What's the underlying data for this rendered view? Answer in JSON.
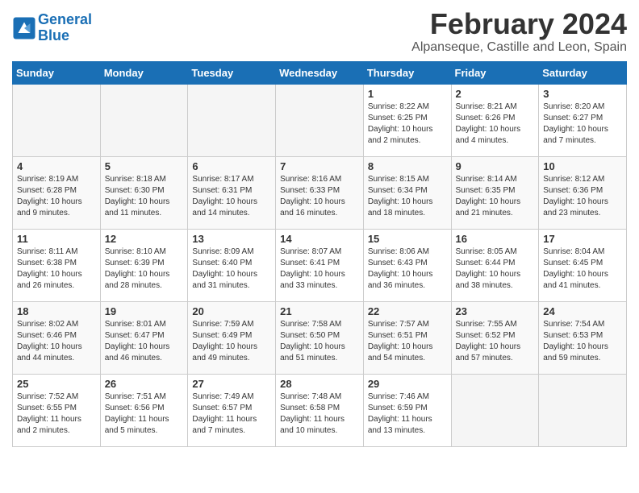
{
  "header": {
    "logo_line1": "General",
    "logo_line2": "Blue",
    "title": "February 2024",
    "subtitle": "Alpanseque, Castille and Leon, Spain"
  },
  "weekdays": [
    "Sunday",
    "Monday",
    "Tuesday",
    "Wednesday",
    "Thursday",
    "Friday",
    "Saturday"
  ],
  "weeks": [
    [
      {
        "day": "",
        "info": ""
      },
      {
        "day": "",
        "info": ""
      },
      {
        "day": "",
        "info": ""
      },
      {
        "day": "",
        "info": ""
      },
      {
        "day": "1",
        "info": "Sunrise: 8:22 AM\nSunset: 6:25 PM\nDaylight: 10 hours\nand 2 minutes."
      },
      {
        "day": "2",
        "info": "Sunrise: 8:21 AM\nSunset: 6:26 PM\nDaylight: 10 hours\nand 4 minutes."
      },
      {
        "day": "3",
        "info": "Sunrise: 8:20 AM\nSunset: 6:27 PM\nDaylight: 10 hours\nand 7 minutes."
      }
    ],
    [
      {
        "day": "4",
        "info": "Sunrise: 8:19 AM\nSunset: 6:28 PM\nDaylight: 10 hours\nand 9 minutes."
      },
      {
        "day": "5",
        "info": "Sunrise: 8:18 AM\nSunset: 6:30 PM\nDaylight: 10 hours\nand 11 minutes."
      },
      {
        "day": "6",
        "info": "Sunrise: 8:17 AM\nSunset: 6:31 PM\nDaylight: 10 hours\nand 14 minutes."
      },
      {
        "day": "7",
        "info": "Sunrise: 8:16 AM\nSunset: 6:33 PM\nDaylight: 10 hours\nand 16 minutes."
      },
      {
        "day": "8",
        "info": "Sunrise: 8:15 AM\nSunset: 6:34 PM\nDaylight: 10 hours\nand 18 minutes."
      },
      {
        "day": "9",
        "info": "Sunrise: 8:14 AM\nSunset: 6:35 PM\nDaylight: 10 hours\nand 21 minutes."
      },
      {
        "day": "10",
        "info": "Sunrise: 8:12 AM\nSunset: 6:36 PM\nDaylight: 10 hours\nand 23 minutes."
      }
    ],
    [
      {
        "day": "11",
        "info": "Sunrise: 8:11 AM\nSunset: 6:38 PM\nDaylight: 10 hours\nand 26 minutes."
      },
      {
        "day": "12",
        "info": "Sunrise: 8:10 AM\nSunset: 6:39 PM\nDaylight: 10 hours\nand 28 minutes."
      },
      {
        "day": "13",
        "info": "Sunrise: 8:09 AM\nSunset: 6:40 PM\nDaylight: 10 hours\nand 31 minutes."
      },
      {
        "day": "14",
        "info": "Sunrise: 8:07 AM\nSunset: 6:41 PM\nDaylight: 10 hours\nand 33 minutes."
      },
      {
        "day": "15",
        "info": "Sunrise: 8:06 AM\nSunset: 6:43 PM\nDaylight: 10 hours\nand 36 minutes."
      },
      {
        "day": "16",
        "info": "Sunrise: 8:05 AM\nSunset: 6:44 PM\nDaylight: 10 hours\nand 38 minutes."
      },
      {
        "day": "17",
        "info": "Sunrise: 8:04 AM\nSunset: 6:45 PM\nDaylight: 10 hours\nand 41 minutes."
      }
    ],
    [
      {
        "day": "18",
        "info": "Sunrise: 8:02 AM\nSunset: 6:46 PM\nDaylight: 10 hours\nand 44 minutes."
      },
      {
        "day": "19",
        "info": "Sunrise: 8:01 AM\nSunset: 6:47 PM\nDaylight: 10 hours\nand 46 minutes."
      },
      {
        "day": "20",
        "info": "Sunrise: 7:59 AM\nSunset: 6:49 PM\nDaylight: 10 hours\nand 49 minutes."
      },
      {
        "day": "21",
        "info": "Sunrise: 7:58 AM\nSunset: 6:50 PM\nDaylight: 10 hours\nand 51 minutes."
      },
      {
        "day": "22",
        "info": "Sunrise: 7:57 AM\nSunset: 6:51 PM\nDaylight: 10 hours\nand 54 minutes."
      },
      {
        "day": "23",
        "info": "Sunrise: 7:55 AM\nSunset: 6:52 PM\nDaylight: 10 hours\nand 57 minutes."
      },
      {
        "day": "24",
        "info": "Sunrise: 7:54 AM\nSunset: 6:53 PM\nDaylight: 10 hours\nand 59 minutes."
      }
    ],
    [
      {
        "day": "25",
        "info": "Sunrise: 7:52 AM\nSunset: 6:55 PM\nDaylight: 11 hours\nand 2 minutes."
      },
      {
        "day": "26",
        "info": "Sunrise: 7:51 AM\nSunset: 6:56 PM\nDaylight: 11 hours\nand 5 minutes."
      },
      {
        "day": "27",
        "info": "Sunrise: 7:49 AM\nSunset: 6:57 PM\nDaylight: 11 hours\nand 7 minutes."
      },
      {
        "day": "28",
        "info": "Sunrise: 7:48 AM\nSunset: 6:58 PM\nDaylight: 11 hours\nand 10 minutes."
      },
      {
        "day": "29",
        "info": "Sunrise: 7:46 AM\nSunset: 6:59 PM\nDaylight: 11 hours\nand 13 minutes."
      },
      {
        "day": "",
        "info": ""
      },
      {
        "day": "",
        "info": ""
      }
    ]
  ]
}
